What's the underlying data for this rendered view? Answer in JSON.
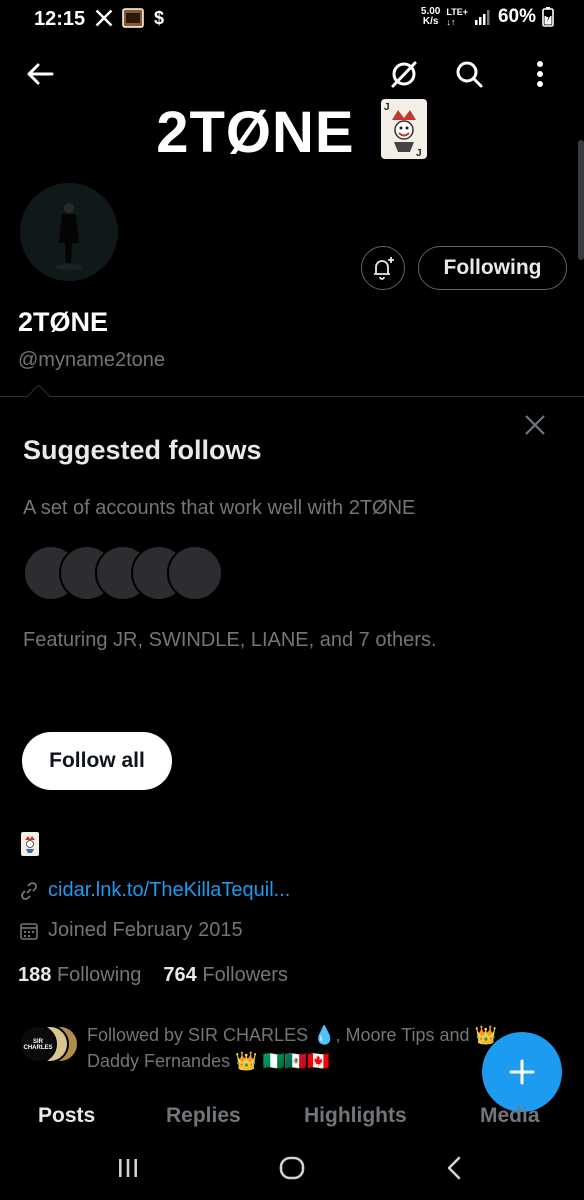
{
  "status_bar": {
    "time": "12:15",
    "net_speed_value": "5.00",
    "net_speed_unit": "K/s",
    "network": "LTE+",
    "battery": "60%"
  },
  "header": {
    "banner_title": "2TØNE"
  },
  "profile": {
    "display_name": "2TØNE",
    "handle": "@myname2tone",
    "following_button": "Following",
    "link": "cidar.lnk.to/TheKillaTequil...",
    "joined": "Joined February 2015",
    "following_count": "188",
    "following_label": "Following",
    "followers_count": "764",
    "followers_label": "Followers",
    "followed_by_line1": "Followed by SIR CHARLES 💧, Moore Tips and 👑",
    "followed_by_line2": "Daddy Fernandes 👑 🇳🇬🇲🇽🇨🇦",
    "followed_by_avatar_text": "SIR CHARLES"
  },
  "suggested": {
    "title": "Suggested follows",
    "description": "A set of accounts that work well with 2TØNE",
    "featuring": "Featuring JR, SWINDLE, LIANE, and 7 others.",
    "follow_all": "Follow all"
  },
  "tabs": [
    {
      "label": "Posts",
      "active": true
    },
    {
      "label": "Replies",
      "active": false
    },
    {
      "label": "Highlights",
      "active": false
    },
    {
      "label": "Media",
      "active": false
    }
  ],
  "colors": {
    "accent": "#1d9bf0",
    "background": "#000000",
    "muted_text": "#71767b",
    "primary_text": "#e7e9ea"
  }
}
